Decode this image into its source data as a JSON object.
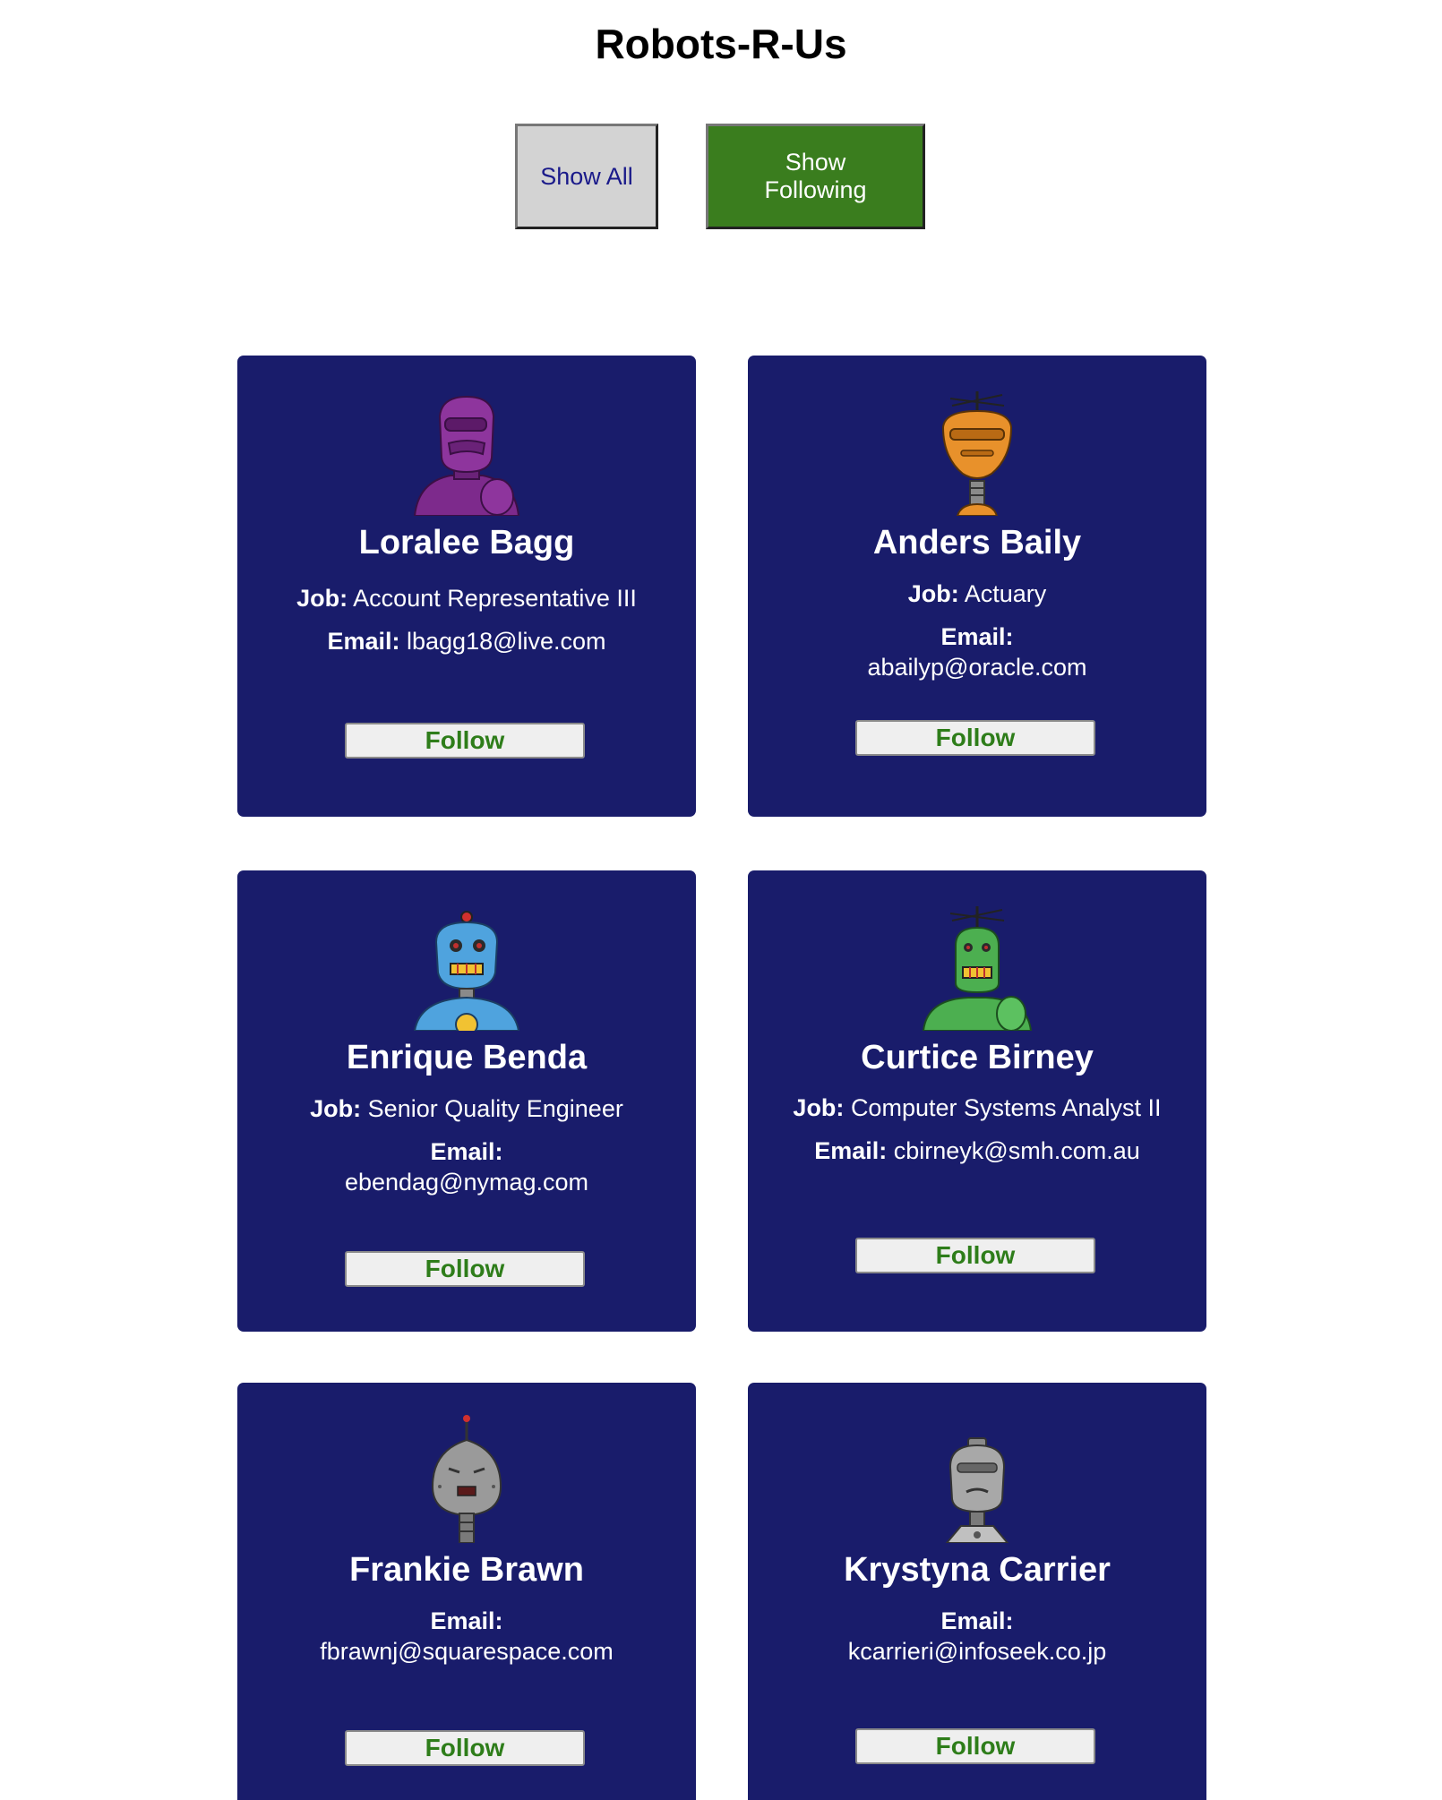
{
  "app": {
    "title": "Robots-R-Us"
  },
  "toolbar": {
    "show_all_label": "Show All",
    "show_following_label": "Show Following"
  },
  "colors": {
    "card_background": "#191c6b",
    "show_following_background": "#3a7d1e",
    "follow_text": "#2e7d1a"
  },
  "robots": [
    {
      "name": "Loralee Bagg",
      "job_label": "Job:",
      "job": "Account Representative III",
      "email_label": "Email:",
      "email": "lbagg18@live.com",
      "follow_label": "Follow",
      "avatar_icon": "purple-robot-icon"
    },
    {
      "name": "Anders Baily",
      "job_label": "Job:",
      "job": "Actuary",
      "email_label": "Email:",
      "email": "abailyp@oracle.com",
      "follow_label": "Follow",
      "avatar_icon": "orange-robot-icon"
    },
    {
      "name": "Enrique Benda",
      "job_label": "Job:",
      "job": "Senior Quality Engineer",
      "email_label": "Email:",
      "email": "ebendag@nymag.com",
      "follow_label": "Follow",
      "avatar_icon": "blue-robot-icon"
    },
    {
      "name": "Curtice Birney",
      "job_label": "Job:",
      "job": "Computer Systems Analyst II",
      "email_label": "Email:",
      "email": "cbirneyk@smh.com.au",
      "follow_label": "Follow",
      "avatar_icon": "green-robot-icon"
    },
    {
      "name": "Frankie Brawn",
      "email_label": "Email:",
      "email": "fbrawnj@squarespace.com",
      "follow_label": "Follow",
      "avatar_icon": "gray-robot-icon"
    },
    {
      "name": "Krystyna Carrier",
      "email_label": "Email:",
      "email": "kcarrieri@infoseek.co.jp",
      "follow_label": "Follow",
      "avatar_icon": "silver-robot-icon"
    }
  ]
}
